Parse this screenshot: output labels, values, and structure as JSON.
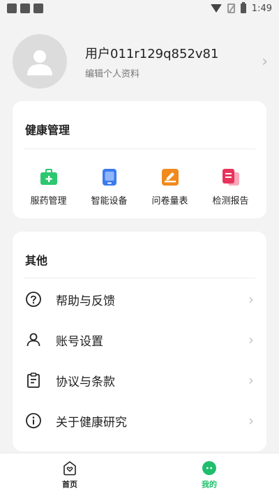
{
  "status_bar": {
    "time": "1:49"
  },
  "profile": {
    "username": "用户011r129q852v81",
    "edit_label": "编辑个人资料",
    "chevron": "›"
  },
  "health": {
    "title": "健康管理",
    "items": [
      {
        "label": "服药管理",
        "icon": "medicine-box-icon",
        "color": "#2cc86f"
      },
      {
        "label": "智能设备",
        "icon": "smart-device-icon",
        "color": "#3a7bf0"
      },
      {
        "label": "问卷量表",
        "icon": "questionnaire-icon",
        "color": "#f08a1c"
      },
      {
        "label": "检测报告",
        "icon": "report-icon",
        "color": "#e8345c"
      }
    ]
  },
  "other": {
    "title": "其他",
    "items": [
      {
        "label": "帮助与反馈",
        "icon": "help-icon"
      },
      {
        "label": "账号设置",
        "icon": "account-icon"
      },
      {
        "label": "协议与条款",
        "icon": "agreement-icon"
      },
      {
        "label": "关于健康研究",
        "icon": "info-icon"
      }
    ],
    "chevron": "›"
  },
  "tabbar": {
    "tabs": [
      {
        "label": "首页",
        "icon": "home-icon",
        "active": false
      },
      {
        "label": "我的",
        "icon": "mine-icon",
        "active": true
      }
    ],
    "active_color": "#1fbe6c",
    "inactive_color": "#222222"
  }
}
